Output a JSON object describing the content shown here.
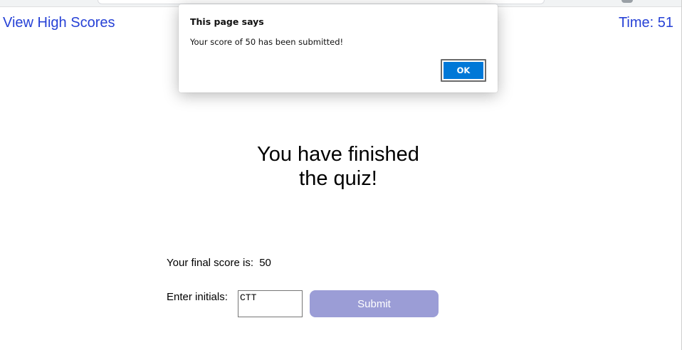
{
  "header": {
    "high_scores_link": "View High Scores",
    "timer": "Time: 51"
  },
  "main": {
    "title": "You have finished the quiz!",
    "score_label": "Your final score is:",
    "score_value": "50",
    "initials_label": "Enter initials:",
    "initials_value": "CTT",
    "submit_label": "Submit"
  },
  "dialog": {
    "title": "This page says",
    "message": "Your score of 50 has been submitted!",
    "ok_label": "OK"
  },
  "colors": {
    "link": "#2641d6",
    "submit_button": "#9b9dd6",
    "ok_button": "#0078d7"
  }
}
